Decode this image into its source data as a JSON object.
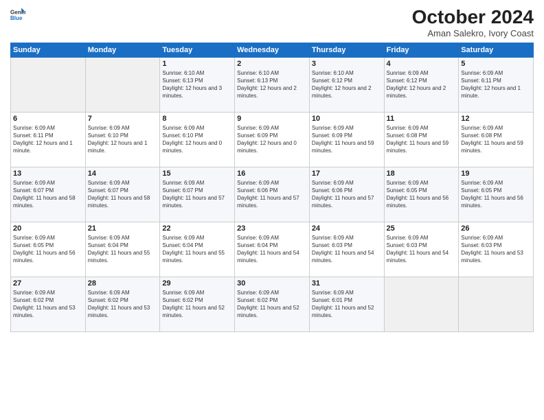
{
  "header": {
    "logo_general": "General",
    "logo_blue": "Blue",
    "title": "October 2024",
    "subtitle": "Aman Salekro, Ivory Coast"
  },
  "days_of_week": [
    "Sunday",
    "Monday",
    "Tuesday",
    "Wednesday",
    "Thursday",
    "Friday",
    "Saturday"
  ],
  "weeks": [
    [
      {
        "day": "",
        "info": ""
      },
      {
        "day": "",
        "info": ""
      },
      {
        "day": "1",
        "info": "Sunrise: 6:10 AM\nSunset: 6:13 PM\nDaylight: 12 hours and 3 minutes."
      },
      {
        "day": "2",
        "info": "Sunrise: 6:10 AM\nSunset: 6:13 PM\nDaylight: 12 hours and 2 minutes."
      },
      {
        "day": "3",
        "info": "Sunrise: 6:10 AM\nSunset: 6:12 PM\nDaylight: 12 hours and 2 minutes."
      },
      {
        "day": "4",
        "info": "Sunrise: 6:09 AM\nSunset: 6:12 PM\nDaylight: 12 hours and 2 minutes."
      },
      {
        "day": "5",
        "info": "Sunrise: 6:09 AM\nSunset: 6:11 PM\nDaylight: 12 hours and 1 minute."
      }
    ],
    [
      {
        "day": "6",
        "info": "Sunrise: 6:09 AM\nSunset: 6:11 PM\nDaylight: 12 hours and 1 minute."
      },
      {
        "day": "7",
        "info": "Sunrise: 6:09 AM\nSunset: 6:10 PM\nDaylight: 12 hours and 1 minute."
      },
      {
        "day": "8",
        "info": "Sunrise: 6:09 AM\nSunset: 6:10 PM\nDaylight: 12 hours and 0 minutes."
      },
      {
        "day": "9",
        "info": "Sunrise: 6:09 AM\nSunset: 6:09 PM\nDaylight: 12 hours and 0 minutes."
      },
      {
        "day": "10",
        "info": "Sunrise: 6:09 AM\nSunset: 6:09 PM\nDaylight: 11 hours and 59 minutes."
      },
      {
        "day": "11",
        "info": "Sunrise: 6:09 AM\nSunset: 6:08 PM\nDaylight: 11 hours and 59 minutes."
      },
      {
        "day": "12",
        "info": "Sunrise: 6:09 AM\nSunset: 6:08 PM\nDaylight: 11 hours and 59 minutes."
      }
    ],
    [
      {
        "day": "13",
        "info": "Sunrise: 6:09 AM\nSunset: 6:07 PM\nDaylight: 11 hours and 58 minutes."
      },
      {
        "day": "14",
        "info": "Sunrise: 6:09 AM\nSunset: 6:07 PM\nDaylight: 11 hours and 58 minutes."
      },
      {
        "day": "15",
        "info": "Sunrise: 6:09 AM\nSunset: 6:07 PM\nDaylight: 11 hours and 57 minutes."
      },
      {
        "day": "16",
        "info": "Sunrise: 6:09 AM\nSunset: 6:06 PM\nDaylight: 11 hours and 57 minutes."
      },
      {
        "day": "17",
        "info": "Sunrise: 6:09 AM\nSunset: 6:06 PM\nDaylight: 11 hours and 57 minutes."
      },
      {
        "day": "18",
        "info": "Sunrise: 6:09 AM\nSunset: 6:05 PM\nDaylight: 11 hours and 56 minutes."
      },
      {
        "day": "19",
        "info": "Sunrise: 6:09 AM\nSunset: 6:05 PM\nDaylight: 11 hours and 56 minutes."
      }
    ],
    [
      {
        "day": "20",
        "info": "Sunrise: 6:09 AM\nSunset: 6:05 PM\nDaylight: 11 hours and 56 minutes."
      },
      {
        "day": "21",
        "info": "Sunrise: 6:09 AM\nSunset: 6:04 PM\nDaylight: 11 hours and 55 minutes."
      },
      {
        "day": "22",
        "info": "Sunrise: 6:09 AM\nSunset: 6:04 PM\nDaylight: 11 hours and 55 minutes."
      },
      {
        "day": "23",
        "info": "Sunrise: 6:09 AM\nSunset: 6:04 PM\nDaylight: 11 hours and 54 minutes."
      },
      {
        "day": "24",
        "info": "Sunrise: 6:09 AM\nSunset: 6:03 PM\nDaylight: 11 hours and 54 minutes."
      },
      {
        "day": "25",
        "info": "Sunrise: 6:09 AM\nSunset: 6:03 PM\nDaylight: 11 hours and 54 minutes."
      },
      {
        "day": "26",
        "info": "Sunrise: 6:09 AM\nSunset: 6:03 PM\nDaylight: 11 hours and 53 minutes."
      }
    ],
    [
      {
        "day": "27",
        "info": "Sunrise: 6:09 AM\nSunset: 6:02 PM\nDaylight: 11 hours and 53 minutes."
      },
      {
        "day": "28",
        "info": "Sunrise: 6:09 AM\nSunset: 6:02 PM\nDaylight: 11 hours and 53 minutes."
      },
      {
        "day": "29",
        "info": "Sunrise: 6:09 AM\nSunset: 6:02 PM\nDaylight: 11 hours and 52 minutes."
      },
      {
        "day": "30",
        "info": "Sunrise: 6:09 AM\nSunset: 6:02 PM\nDaylight: 11 hours and 52 minutes."
      },
      {
        "day": "31",
        "info": "Sunrise: 6:09 AM\nSunset: 6:01 PM\nDaylight: 11 hours and 52 minutes."
      },
      {
        "day": "",
        "info": ""
      },
      {
        "day": "",
        "info": ""
      }
    ]
  ]
}
